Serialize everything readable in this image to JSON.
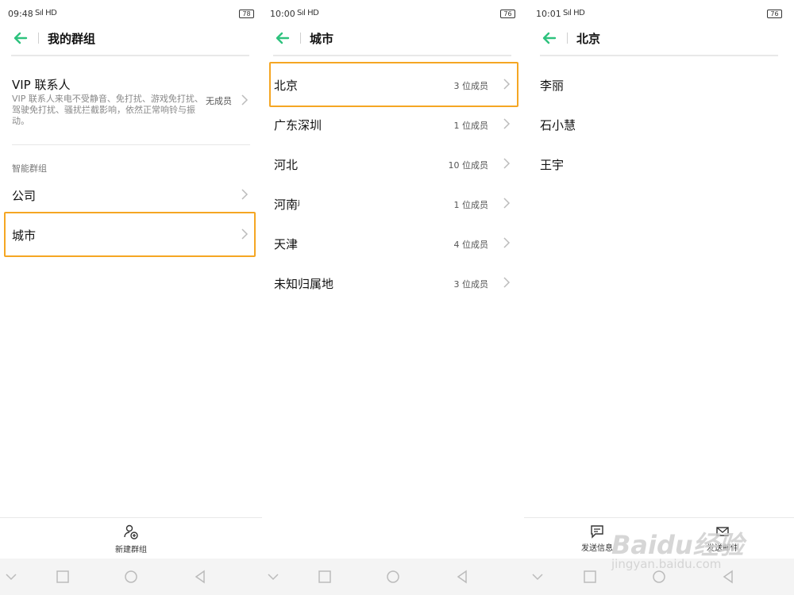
{
  "colors": {
    "accent": "#2ec27e",
    "highlight": "#f5a623"
  },
  "screen1": {
    "status": {
      "time": "09:48",
      "signal": "Sıl HD",
      "battery": "78"
    },
    "header": {
      "title": "我的群组",
      "back_icon": "arrow-left-icon"
    },
    "vip": {
      "label": "VIP 联系人",
      "desc": "VIP 联系人来电不受静音、免打扰、游戏免打扰、驾驶免打扰、骚扰拦截影响，依然正常响铃与振动。",
      "count": "无成员"
    },
    "section_title": "智能群组",
    "groups": [
      {
        "label": "公司"
      },
      {
        "label": "城市"
      }
    ],
    "toolbar": {
      "new_group": "新建群组"
    }
  },
  "screen2": {
    "status": {
      "time": "10:00",
      "signal": "Sıl HD",
      "battery": "76"
    },
    "header": {
      "title": "城市"
    },
    "cities": [
      {
        "label": "北京",
        "count": "3 位成员"
      },
      {
        "label": "广东深圳",
        "count": "1 位成员"
      },
      {
        "label": "河北",
        "count": "10 位成员"
      },
      {
        "label": "河南ʲ",
        "count": "1 位成员"
      },
      {
        "label": "天津",
        "count": "4 位成员"
      },
      {
        "label": "未知归属地",
        "count": "3 位成员"
      }
    ]
  },
  "screen3": {
    "status": {
      "time": "10:01",
      "signal": "Sıl HD",
      "battery": "76"
    },
    "header": {
      "title": "北京"
    },
    "members": [
      {
        "label": "李丽"
      },
      {
        "label": "石小慧"
      },
      {
        "label": "王宇"
      }
    ],
    "toolbar": {
      "send_message": "发送信息",
      "send_email": "发送邮件"
    }
  },
  "watermark": {
    "logo": "Baidu经验",
    "url": "jingyan.baidu.com"
  }
}
